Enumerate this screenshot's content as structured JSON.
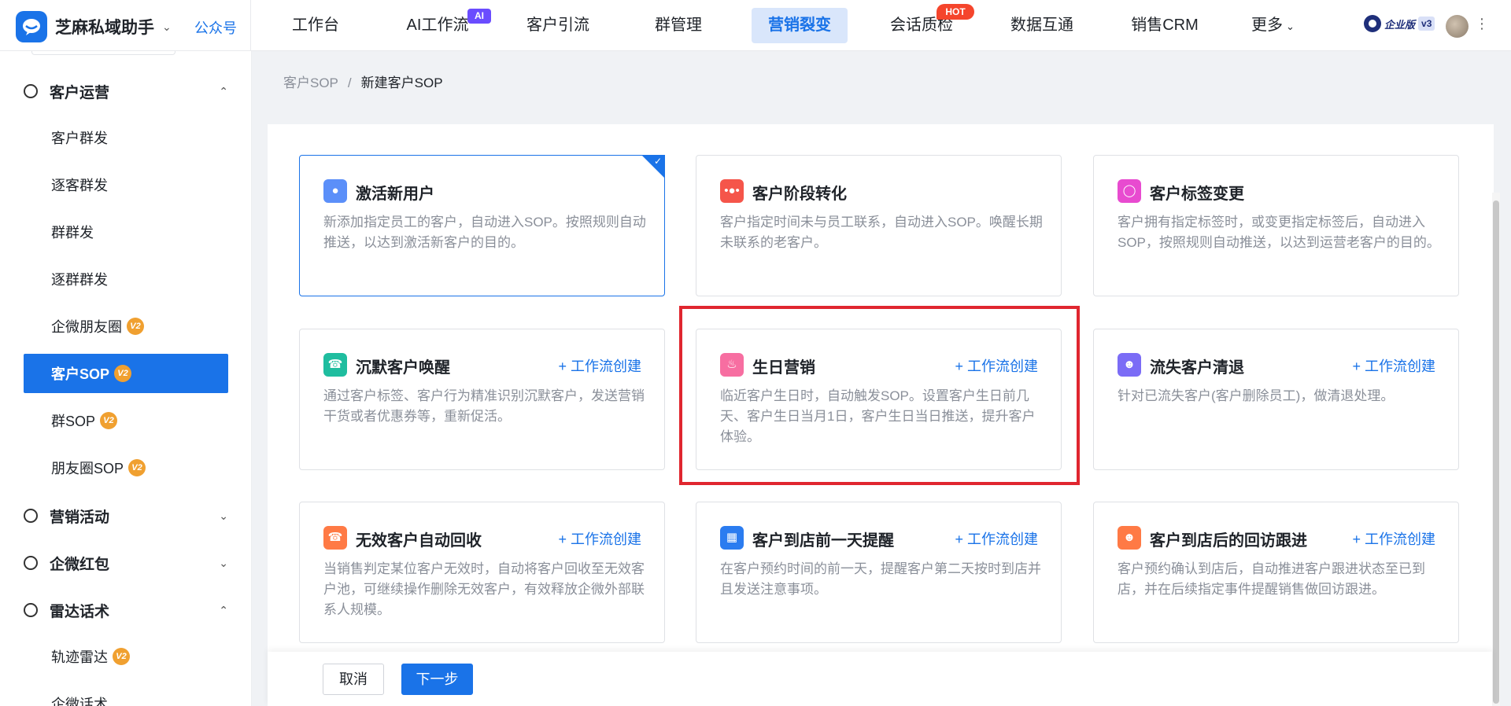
{
  "app": {
    "name": "芝麻私域助手",
    "sub_link": "公众号",
    "edition_label": "企业版",
    "edition_version": "v3"
  },
  "nav": {
    "items": [
      {
        "label": "工作台"
      },
      {
        "label": "AI工作流",
        "badge": "AI"
      },
      {
        "label": "客户引流"
      },
      {
        "label": "群管理"
      },
      {
        "label": "营销裂变",
        "active": true
      },
      {
        "label": "会话质检",
        "badge": "HOT"
      },
      {
        "label": "数据互通"
      },
      {
        "label": "销售CRM"
      },
      {
        "label": "更多"
      }
    ]
  },
  "sidebar": {
    "groups": [
      {
        "label": "客户运营",
        "expanded": true
      },
      {
        "label": "营销活动",
        "expanded": false
      },
      {
        "label": "企微红包",
        "expanded": false
      },
      {
        "label": "雷达话术",
        "expanded": true
      }
    ],
    "items": [
      {
        "label": "客户群发"
      },
      {
        "label": "逐客群发"
      },
      {
        "label": "群群发"
      },
      {
        "label": "逐群群发"
      },
      {
        "label": "企微朋友圈",
        "badge": "V2"
      },
      {
        "label": "客户SOP",
        "badge": "V2",
        "active": true
      },
      {
        "label": "群SOP",
        "badge": "V2"
      },
      {
        "label": "朋友圈SOP",
        "badge": "V2"
      },
      {
        "label": "轨迹雷达",
        "badge": "V2"
      },
      {
        "label": "企微话术"
      }
    ]
  },
  "breadcrumb": {
    "parent": "客户SOP",
    "separator": "/",
    "current": "新建客户SOP"
  },
  "cards": [
    {
      "title": "激活新用户",
      "desc": "新添加指定员工的客户，自动进入SOP。按照规则自动推送，以达到激活新客户的目的。",
      "icon": "activate-icon",
      "color": "#5b8ff9",
      "selected": true
    },
    {
      "title": "客户阶段转化",
      "desc": "客户指定时间未与员工联系，自动进入SOP。唤醒长期未联系的老客户。",
      "icon": "stage-icon",
      "color": "#f5554a"
    },
    {
      "title": "客户标签变更",
      "desc": "客户拥有指定标签时，或变更指定标签后，自动进入SOP，按照规则自动推送，以达到运营老客户的目的。",
      "icon": "tag-icon",
      "color": "#e84bd0"
    },
    {
      "title": "沉默客户唤醒",
      "desc": "通过客户标签、客户行为精准识别沉默客户，发送营销干货或者优惠券等，重新促活。",
      "icon": "wake-icon",
      "color": "#1fbd9f",
      "action": "工作流创建"
    },
    {
      "title": "生日营销",
      "desc": "临近客户生日时，自动触发SOP。设置客户生日前几天、客户生日当月1日，客户生日当日推送，提升客户体验。",
      "icon": "birthday-icon",
      "color": "#f76ea1",
      "action": "工作流创建"
    },
    {
      "title": "流失客户清退",
      "desc": "针对已流失客户(客户删除员工)，做清退处理。",
      "icon": "user-remove-icon",
      "color": "#7b6cf6",
      "action": "工作流创建"
    },
    {
      "title": "无效客户自动回收",
      "desc": "当销售判定某位客户无效时，自动将客户回收至无效客户池，可继续操作删除无效客户，有效释放企微外部联系人规模。",
      "icon": "recycle-icon",
      "color": "#ff7a45",
      "action": "工作流创建"
    },
    {
      "title": "客户到店前一天提醒",
      "desc": "在客户预约时间的前一天，提醒客户第二天按时到店并且发送注意事项。",
      "icon": "store-icon",
      "color": "#2b7cf0",
      "action": "工作流创建"
    },
    {
      "title": "客户到店后的回访跟进",
      "desc": "客户预约确认到店后，自动推进客户跟进状态至已到店，并在后续指定事件提醒销售做回访跟进。",
      "icon": "followup-icon",
      "color": "#ff7a45",
      "action": "工作流创建"
    }
  ],
  "footer": {
    "cancel_label": "取消",
    "next_label": "下一步"
  }
}
